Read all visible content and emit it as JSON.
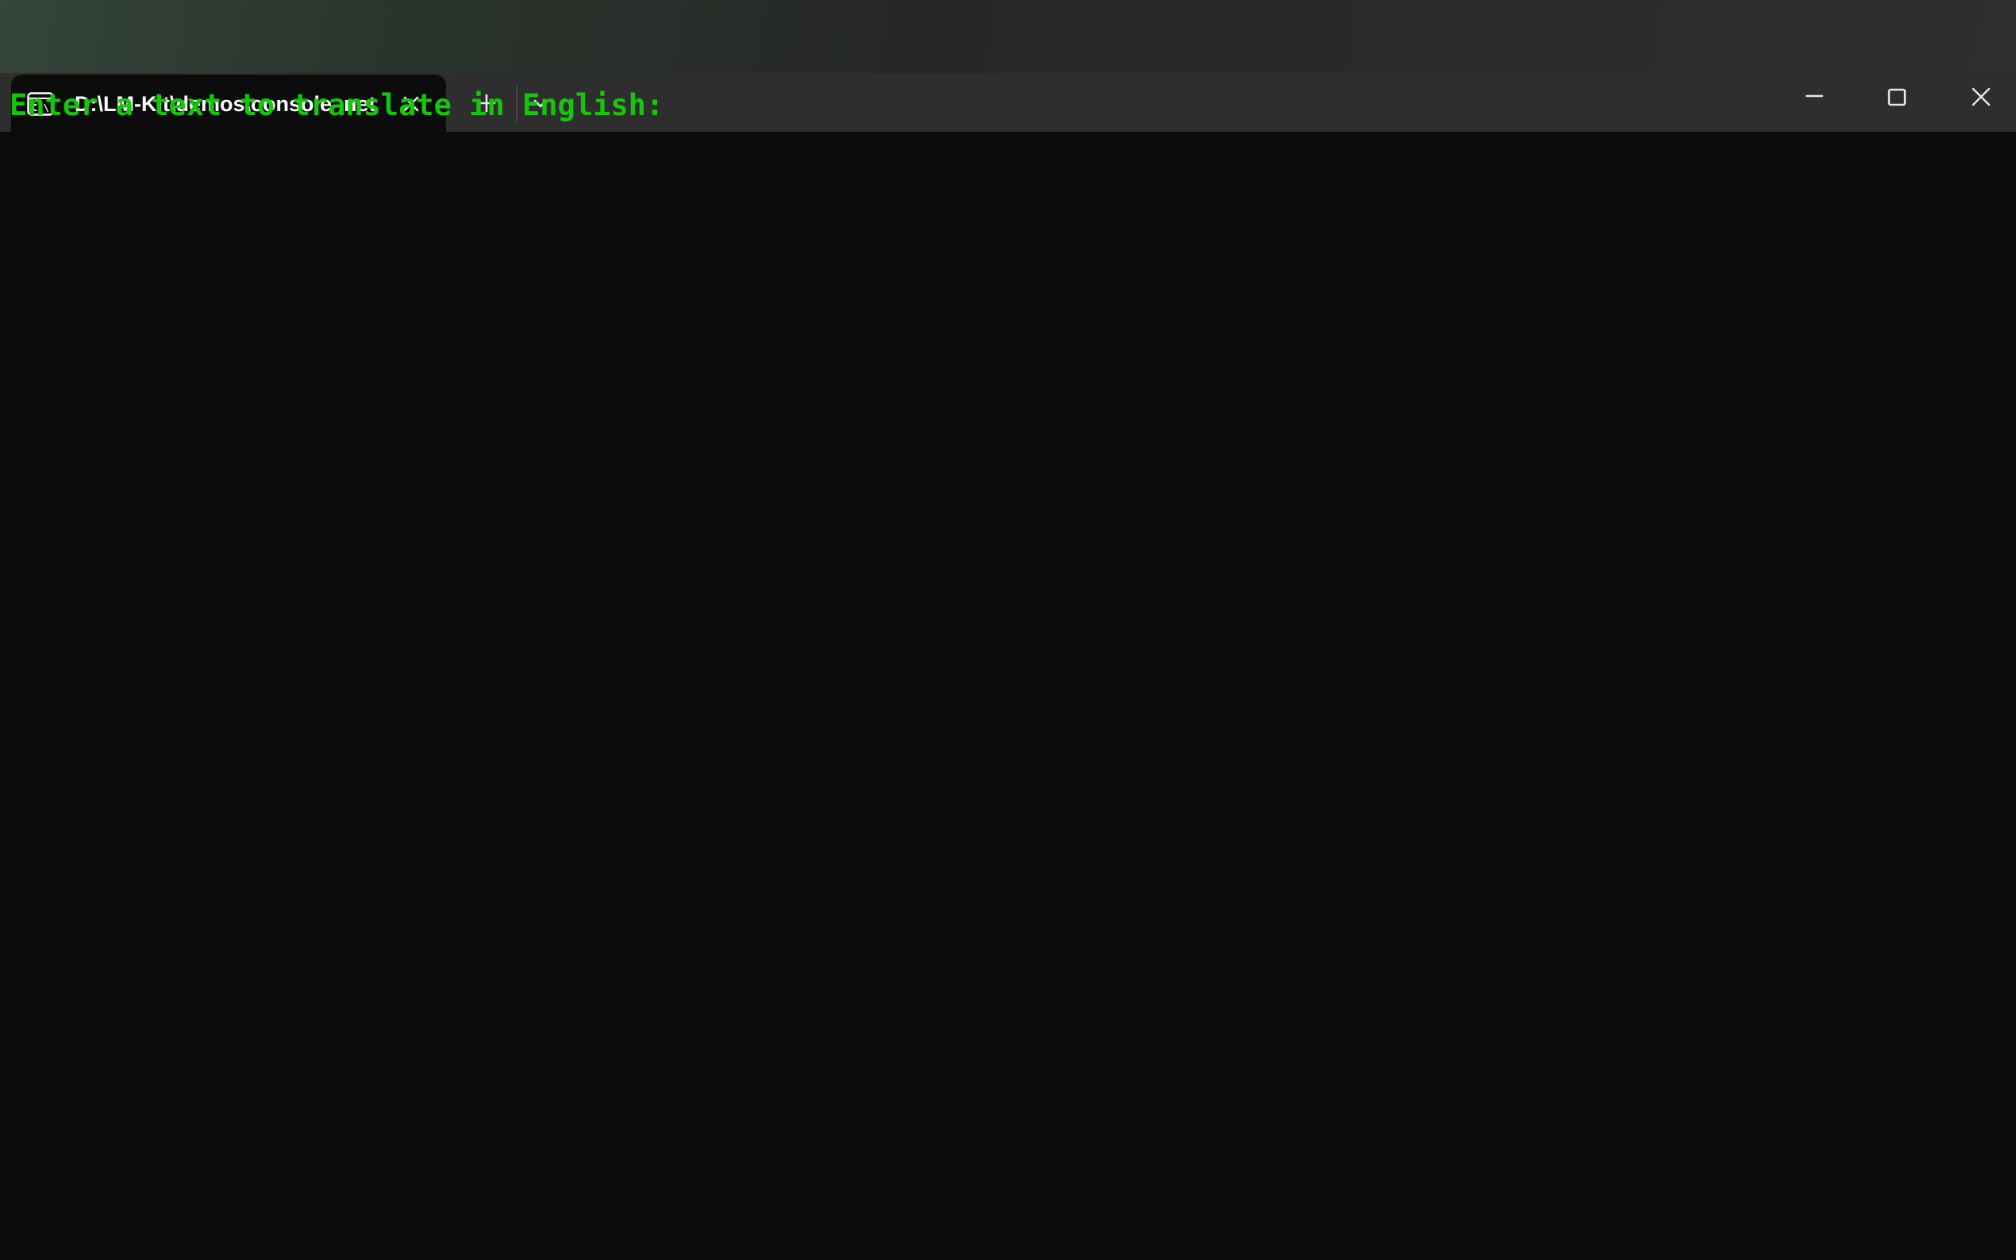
{
  "terminal": {
    "tab": {
      "icon": "console-icon",
      "title": "D:\\LM-Kit\\demos\\console_net",
      "close_icon": "close-icon"
    },
    "toolbar": {
      "new_tab_icon": "plus-icon",
      "dropdown_icon": "chevron-down-icon"
    },
    "window_controls": {
      "minimize_icon": "minimize-icon",
      "maximize_icon": "maximize-icon",
      "close_icon": "close-icon"
    },
    "colors": {
      "titlebar": "#2e2e2e",
      "console_background": "#0c0c0c",
      "prompt_text": "#16c60c"
    }
  },
  "console": {
    "prompt": "Enter a text to translate in English:"
  }
}
